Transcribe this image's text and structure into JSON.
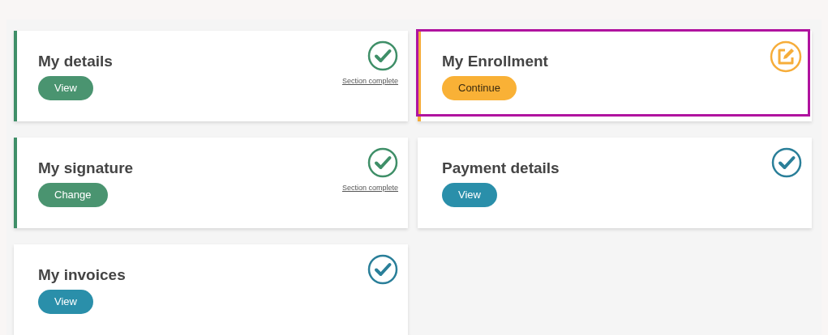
{
  "cards": [
    {
      "title": "My details",
      "kind": "complete",
      "button": "View",
      "status_link": "Section complete",
      "highlighted": false
    },
    {
      "title": "My Enrollment",
      "kind": "in_progress",
      "button": "Continue",
      "highlighted": true
    },
    {
      "title": "My signature",
      "kind": "complete",
      "button": "Change",
      "status_link": "Section complete",
      "highlighted": false
    },
    {
      "title": "Payment details",
      "kind": "ready",
      "button": "View",
      "highlighted": false
    },
    {
      "title": "My invoices",
      "kind": "ready",
      "button": "View",
      "highlighted": false
    }
  ]
}
